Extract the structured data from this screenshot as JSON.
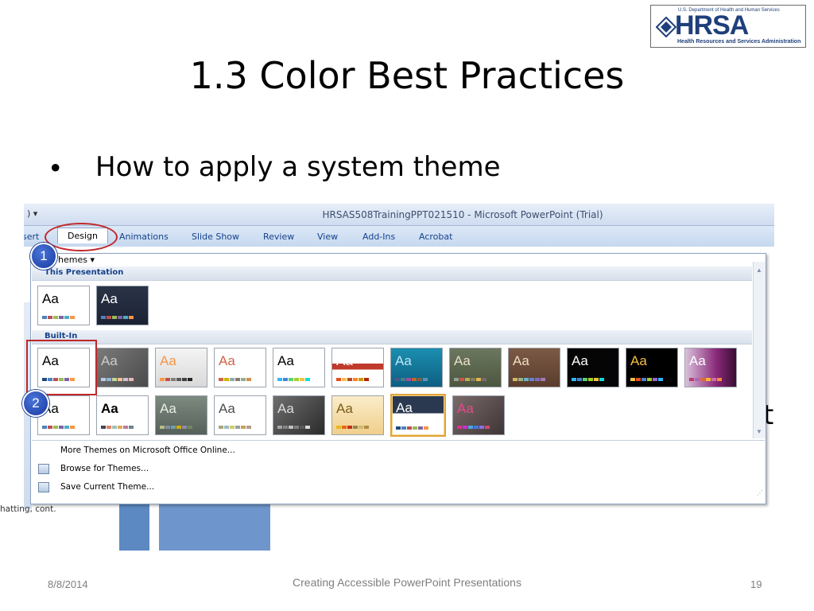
{
  "slide": {
    "title": "1.3 Color Best Practices",
    "bullet_symbol": "•",
    "bullet_text": "How to apply a system theme",
    "footer_date": "8/8/2014",
    "footer_center": "Creating Accessible PowerPoint Presentations",
    "footer_page": "19"
  },
  "logo": {
    "top_text": "U.S. Department of Health and Human Services",
    "main_text": "HRSA",
    "sub_text": "Health Resources and Services Administration"
  },
  "window": {
    "qat": ") ▾",
    "title": "HRSAS508TrainingPPT021510 - Microsoft PowerPoint (Trial)",
    "tabs": [
      {
        "label": "sert"
      },
      {
        "label": "Design"
      },
      {
        "label": "Animations"
      },
      {
        "label": "Slide Show"
      },
      {
        "label": "Review"
      },
      {
        "label": "View"
      },
      {
        "label": "Add-Ins"
      },
      {
        "label": "Acrobat"
      }
    ]
  },
  "gallery": {
    "label": "hemes ▾",
    "section_this": "This Presentation",
    "section_builtin": "Built-In",
    "thumb_text": "Aa",
    "menu": [
      {
        "label": "More Themes on Microsoft Office Online..."
      },
      {
        "label": "Browse for Themes..."
      },
      {
        "label": "Save Current Theme..."
      }
    ],
    "colors": {
      "selection": "#e2a33b",
      "annotation_red": "#c0282a",
      "badge_blue": "#1737a0"
    }
  },
  "badges": {
    "one": "1",
    "two": "2"
  },
  "background": {
    "status_text": "hatting, cont.",
    "right_glyph": "t"
  }
}
